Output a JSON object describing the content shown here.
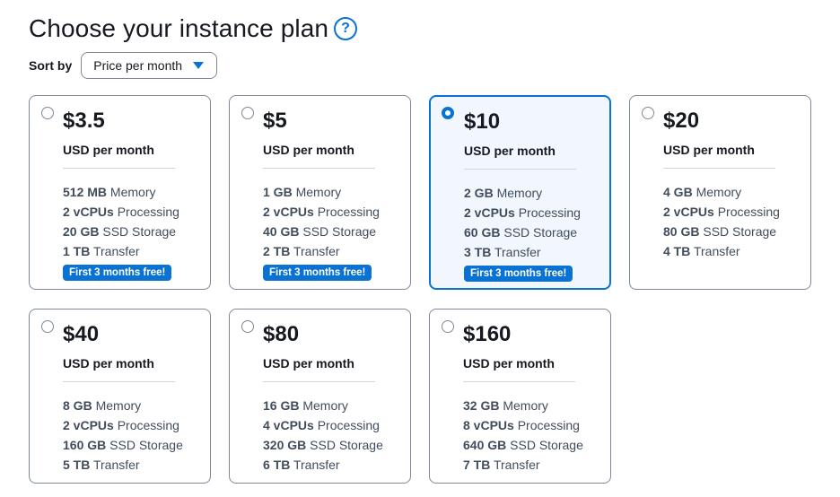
{
  "header": {
    "title": "Choose your instance plan",
    "help": "?"
  },
  "sort": {
    "label": "Sort by",
    "selected": "Price per month"
  },
  "colors": {
    "accent": "#0972d3",
    "selected_bg": "#f1f7fd",
    "border": "#7d8998"
  },
  "plans": [
    {
      "price": "$3.5",
      "unit": "USD per month",
      "selected": false,
      "specs": [
        {
          "value": "512 MB",
          "label": "Memory"
        },
        {
          "value": "2 vCPUs",
          "label": "Processing"
        },
        {
          "value": "20 GB",
          "label": "SSD Storage"
        },
        {
          "value": "1 TB",
          "label": "Transfer"
        }
      ],
      "badge": "First 3 months free!"
    },
    {
      "price": "$5",
      "unit": "USD per month",
      "selected": false,
      "specs": [
        {
          "value": "1 GB",
          "label": "Memory"
        },
        {
          "value": "2 vCPUs",
          "label": "Processing"
        },
        {
          "value": "40 GB",
          "label": "SSD Storage"
        },
        {
          "value": "2 TB",
          "label": "Transfer"
        }
      ],
      "badge": "First 3 months free!"
    },
    {
      "price": "$10",
      "unit": "USD per month",
      "selected": true,
      "specs": [
        {
          "value": "2 GB",
          "label": "Memory"
        },
        {
          "value": "2 vCPUs",
          "label": "Processing"
        },
        {
          "value": "60 GB",
          "label": "SSD Storage"
        },
        {
          "value": "3 TB",
          "label": "Transfer"
        }
      ],
      "badge": "First 3 months free!"
    },
    {
      "price": "$20",
      "unit": "USD per month",
      "selected": false,
      "specs": [
        {
          "value": "4 GB",
          "label": "Memory"
        },
        {
          "value": "2 vCPUs",
          "label": "Processing"
        },
        {
          "value": "80 GB",
          "label": "SSD Storage"
        },
        {
          "value": "4 TB",
          "label": "Transfer"
        }
      ],
      "badge": ""
    },
    {
      "price": "$40",
      "unit": "USD per month",
      "selected": false,
      "specs": [
        {
          "value": "8 GB",
          "label": "Memory"
        },
        {
          "value": "2 vCPUs",
          "label": "Processing"
        },
        {
          "value": "160 GB",
          "label": "SSD Storage"
        },
        {
          "value": "5 TB",
          "label": "Transfer"
        }
      ],
      "badge": ""
    },
    {
      "price": "$80",
      "unit": "USD per month",
      "selected": false,
      "specs": [
        {
          "value": "16 GB",
          "label": "Memory"
        },
        {
          "value": "4 vCPUs",
          "label": "Processing"
        },
        {
          "value": "320 GB",
          "label": "SSD Storage"
        },
        {
          "value": "6 TB",
          "label": "Transfer"
        }
      ],
      "badge": ""
    },
    {
      "price": "$160",
      "unit": "USD per month",
      "selected": false,
      "specs": [
        {
          "value": "32 GB",
          "label": "Memory"
        },
        {
          "value": "8 vCPUs",
          "label": "Processing"
        },
        {
          "value": "640 GB",
          "label": "SSD Storage"
        },
        {
          "value": "7 TB",
          "label": "Transfer"
        }
      ],
      "badge": ""
    }
  ]
}
